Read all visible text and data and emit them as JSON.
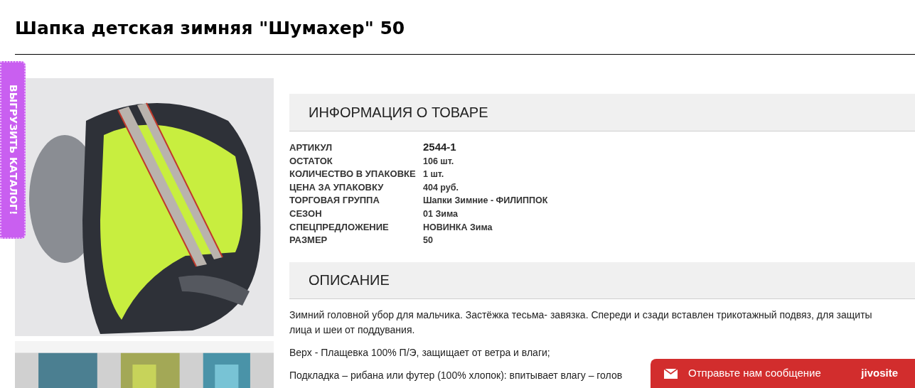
{
  "title": "Шапка детская зимняя \"Шумахер\" 50",
  "side_tab": {
    "label": "ВЫГРУЗИТЬ КАТАЛОГ!"
  },
  "info": {
    "heading": "ИНФОРМАЦИЯ О ТОВАРЕ",
    "rows": [
      {
        "label": "АРТИКУЛ",
        "value": "2544-1",
        "kind": "primary"
      },
      {
        "label": "ОСТАТОК",
        "value": "106 шт.",
        "kind": "plain"
      },
      {
        "label": "КОЛИЧЕСТВО В УПАКОВКЕ",
        "value": "1 шт.",
        "kind": "plain"
      },
      {
        "label": "ЦЕНА ЗА УПАКОВКУ",
        "value": "404 руб.",
        "kind": "plain"
      },
      {
        "label": "ТОРГОВАЯ ГРУППА",
        "value": "Шапки Зимние - ФИЛИППОК",
        "kind": "plain"
      },
      {
        "label": "СЕЗОН",
        "value": "01 Зима",
        "kind": "plain"
      },
      {
        "label": "СПЕЦПРЕДЛОЖЕНИЕ",
        "value": "НОВИНКА Зима",
        "kind": "plain"
      },
      {
        "label": "РАЗМЕР",
        "value": "50",
        "kind": "plain"
      }
    ]
  },
  "description": {
    "heading": "ОПИСАНИЕ",
    "paragraphs": [
      "Зимний головной убор для мальчика. Застёжка тесьма- завязка. Спереди и сзади вставлен трикотажный подвяз, для защиты лица и шеи от поддувания.",
      "Верх - Плащевка 100% П/Э, защищает от ветра и влаги;",
      "Подкладка – рибана или футер (100% хлопок): впитывает влагу – голов"
    ]
  },
  "chat_widget": {
    "label": "Отправьте нам сообщение",
    "brand": "jivosite"
  }
}
